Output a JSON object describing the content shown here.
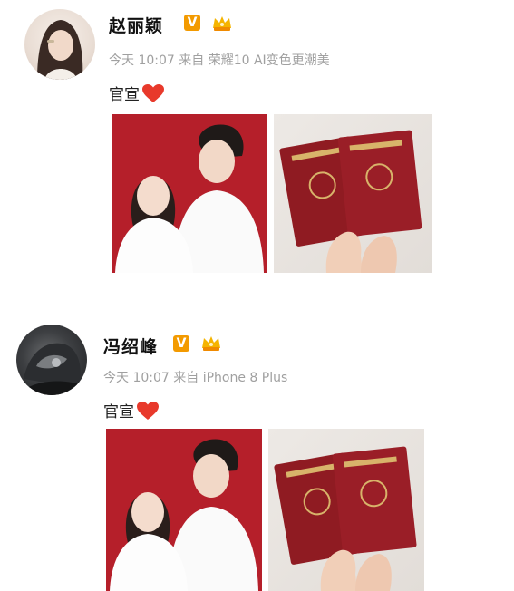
{
  "posts": [
    {
      "author": "赵丽颖",
      "verified_badge": "V",
      "meta": "今天 10:07 来自 荣耀10 AI变色更潮美",
      "content": "官宣"
    },
    {
      "author": "冯绍峰",
      "verified_badge": "V",
      "meta": "今天 10:07 来自 iPhone 8 Plus",
      "content": "官宣"
    }
  ],
  "colors": {
    "badge": "#f39a00",
    "heart": "#e8392b",
    "photo_background": "#b51f2a",
    "certificate": "#8f1b22"
  },
  "icons": {
    "verified": "verified-v-icon",
    "crown": "crown-icon",
    "heart": "heart-icon"
  }
}
